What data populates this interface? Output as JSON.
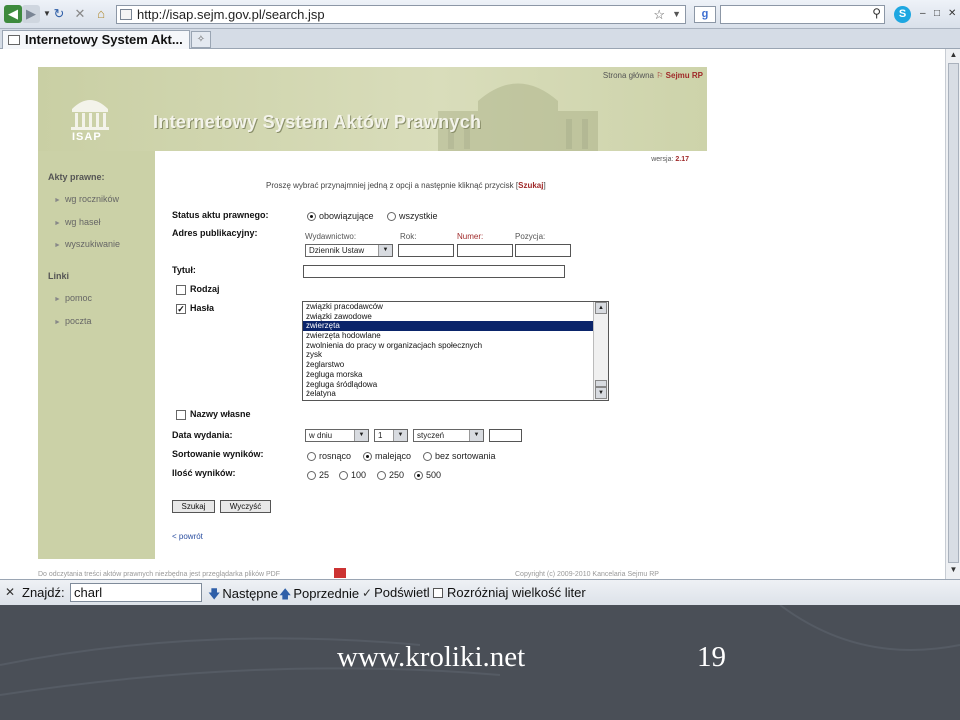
{
  "browser": {
    "url": "http://isap.sejm.gov.pl/search.jsp",
    "tab_title": "Internetowy System Akt...",
    "search_engine_icon": "g"
  },
  "site": {
    "logo_text": "ISAP",
    "title": "Internetowy System Aktów Prawnych",
    "top_nav": {
      "home": "Strona główna",
      "sejm": "Sejmu RP"
    },
    "version_label": "wersja:",
    "version": "2.17",
    "sidebar": {
      "section1": "Akty prawne:",
      "items1": [
        "wg roczników",
        "wg haseł",
        "wyszukiwanie"
      ],
      "section2": "Linki",
      "items2": [
        "pomoc",
        "poczta"
      ]
    },
    "instruction": "Proszę wybrać przynajmniej jedną z opcji a następnie kliknąć przycisk [",
    "instruction_btn": "Szukaj",
    "instruction_end": "]"
  },
  "form": {
    "status_label": "Status aktu prawnego:",
    "status_opt1": "obowiązujące",
    "status_opt2": "wszystkie",
    "status_selected": "obowiązujące",
    "address_label": "Adres publikacyjny:",
    "sub_wydawnictwo": "Wydawnictwo:",
    "sub_rok": "Rok:",
    "sub_numer": "Numer:",
    "sub_pozycja": "Pozycja:",
    "wydawnictwo_value": "Dziennik Ustaw",
    "title_label": "Tytuł:",
    "rodzaj_label": "Rodzaj",
    "rodzaj_checked": false,
    "hasla_label": "Hasła",
    "hasla_checked": true,
    "keywords": [
      "związki pracodawców",
      "związki zawodowe",
      "zwierzęta",
      "zwierzęta hodowlane",
      "zwolnienia do pracy w organizacjach społecznych",
      "zysk",
      "żeglarstwo",
      "żegluga morska",
      "żegluga śródlądowa",
      "żelatyna"
    ],
    "keyword_selected": "zwierzęta",
    "nazwy_label": "Nazwy własne",
    "nazwy_checked": false,
    "date_label": "Data wydania:",
    "date_mode": "w dniu",
    "date_day": "1",
    "date_month": "styczeń",
    "sort_label": "Sortowanie wyników:",
    "sort_opt1": "rosnąco",
    "sort_opt2": "malejąco",
    "sort_opt3": "bez sortowania",
    "sort_selected": "malejąco",
    "count_label": "Ilość wyników:",
    "count_opts": [
      "25",
      "100",
      "250",
      "500"
    ],
    "count_selected": "500",
    "search_btn": "Szukaj",
    "clear_btn": "Wyczyść",
    "back_link": "< powrót"
  },
  "footer": {
    "left": "Do odczytania treści aktów prawnych niezbędna jest przeglądarka plików PDF",
    "right": "Copyright (c) 2009-2010 Kancelaria Sejmu RP"
  },
  "findbar": {
    "label": "Znajdź:",
    "value": "charl",
    "next": "Następne",
    "prev": "Poprzednie",
    "highlight": "Podświetl",
    "match_case": "Rozróżniaj wielkość liter"
  },
  "slide": {
    "url": "www.kroliki.net",
    "page_number": "19"
  }
}
